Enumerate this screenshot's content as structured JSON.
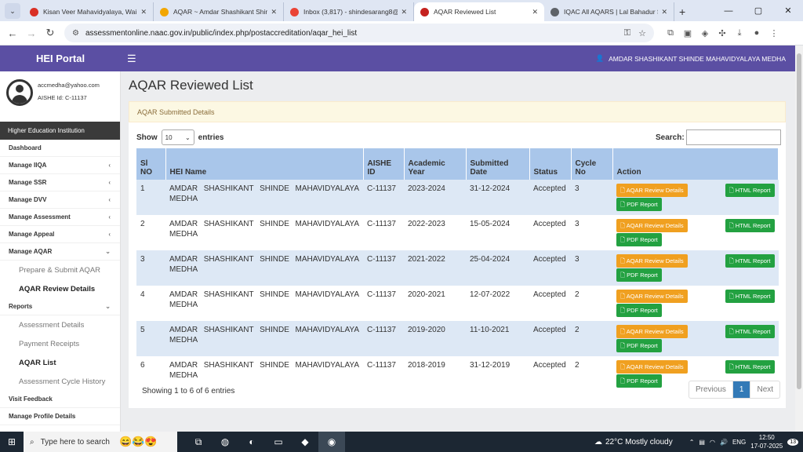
{
  "browser": {
    "tabs": [
      {
        "title": "Kisan Veer Mahavidyalaya, Wai",
        "fav_color": "#d93025",
        "active": false
      },
      {
        "title": "AQAR ~ Amdar Shashikant Shinde",
        "fav_color": "#f2a600",
        "active": false
      },
      {
        "title": "Inbox (3,817) - shindesarang8@",
        "fav_color": "#ea4335",
        "active": false
      },
      {
        "title": "AQAR Reviewed List",
        "fav_color": "#c5221f",
        "active": true
      },
      {
        "title": "IQAC All AQARS | Lal Bahadur Sh",
        "fav_color": "#5f6368",
        "active": false
      }
    ],
    "url": "assessmentonline.naac.gov.in/public/index.php/postaccreditation/aqar_hei_list"
  },
  "header": {
    "brand": "HEI Portal",
    "user_name": "AMDAR SHASHIKANT SHINDE MAHAVIDYALAYA MEDHA"
  },
  "profile": {
    "email": "accmedha@yahoo.com",
    "aishe": "AISHE Id: C-11137"
  },
  "sidebar": {
    "section": "Higher Education Institution",
    "items": [
      {
        "label": "Dashboard",
        "chevron": ""
      },
      {
        "label": "Manage IIQA",
        "chevron": "‹"
      },
      {
        "label": "Manage SSR",
        "chevron": "‹"
      },
      {
        "label": "Manage DVV",
        "chevron": "‹"
      },
      {
        "label": "Manage Assessment",
        "chevron": "‹"
      },
      {
        "label": "Manage Appeal",
        "chevron": "‹"
      },
      {
        "label": "Manage AQAR",
        "chevron": "⌄"
      }
    ],
    "aqar_sub": [
      {
        "label": "Prepare & Submit AQAR",
        "bold": false
      },
      {
        "label": "AQAR Review Details",
        "bold": true
      }
    ],
    "reports": {
      "label": "Reports",
      "chevron": "⌄"
    },
    "reports_sub": [
      {
        "label": "Assessment Details",
        "bold": false
      },
      {
        "label": "Payment Receipts",
        "bold": false
      },
      {
        "label": "AQAR List",
        "bold": true
      },
      {
        "label": "Assessment Cycle History",
        "bold": false
      }
    ],
    "bottom": [
      {
        "label": "Visit Feedback"
      },
      {
        "label": "Manage Profile Details"
      }
    ]
  },
  "main": {
    "title": "AQAR Reviewed List",
    "alert": "AQAR Submitted Details",
    "show_label": "Show",
    "entries_value": "10",
    "entries_label": "entries",
    "search_label": "Search:",
    "columns": [
      "Sl NO",
      "HEI Name",
      "AISHE ID",
      "Academic Year",
      "Submitted Date",
      "Status",
      "Cycle No",
      "Action"
    ],
    "rows": [
      {
        "no": "1",
        "name": "AMDAR SHASHIKANT SHINDE MAHAVIDYALAYA MEDHA",
        "aishe": "C-11137",
        "year": "2023-2024",
        "date": "31-12-2024",
        "status": "Accepted",
        "cycle": "3"
      },
      {
        "no": "2",
        "name": "AMDAR SHASHIKANT SHINDE MAHAVIDYALAYA MEDHA",
        "aishe": "C-11137",
        "year": "2022-2023",
        "date": "15-05-2024",
        "status": "Accepted",
        "cycle": "3"
      },
      {
        "no": "3",
        "name": "AMDAR SHASHIKANT SHINDE MAHAVIDYALAYA MEDHA",
        "aishe": "C-11137",
        "year": "2021-2022",
        "date": "25-04-2024",
        "status": "Accepted",
        "cycle": "3"
      },
      {
        "no": "4",
        "name": "AMDAR SHASHIKANT SHINDE MAHAVIDYALAYA MEDHA",
        "aishe": "C-11137",
        "year": "2020-2021",
        "date": "12-07-2022",
        "status": "Accepted",
        "cycle": "2"
      },
      {
        "no": "5",
        "name": "AMDAR SHASHIKANT SHINDE MAHAVIDYALAYA MEDHA",
        "aishe": "C-11137",
        "year": "2019-2020",
        "date": "11-10-2021",
        "status": "Accepted",
        "cycle": "2"
      },
      {
        "no": "6",
        "name": "AMDAR SHASHIKANT SHINDE MAHAVIDYALAYA MEDHA",
        "aishe": "C-11137",
        "year": "2018-2019",
        "date": "31-12-2019",
        "status": "Accepted",
        "cycle": "2"
      }
    ],
    "btn_review": "AQAR Review Details",
    "btn_pdf": "PDF Report",
    "btn_html": "HTML Report",
    "showing": "Showing 1 to 6 of 6 entries",
    "pager": {
      "prev": "Previous",
      "page": "1",
      "next": "Next"
    }
  },
  "taskbar": {
    "search_placeholder": "Type here to search",
    "weather": "22°C  Mostly cloudy",
    "lang": "ENG",
    "time": "12:50",
    "date": "17-07-2025",
    "notif": "13"
  },
  "colors": {
    "topbar": "#5b4fa3",
    "review_btn": "#f0a020",
    "green_btn": "#23a141",
    "table_head": "#a9c6ea"
  }
}
